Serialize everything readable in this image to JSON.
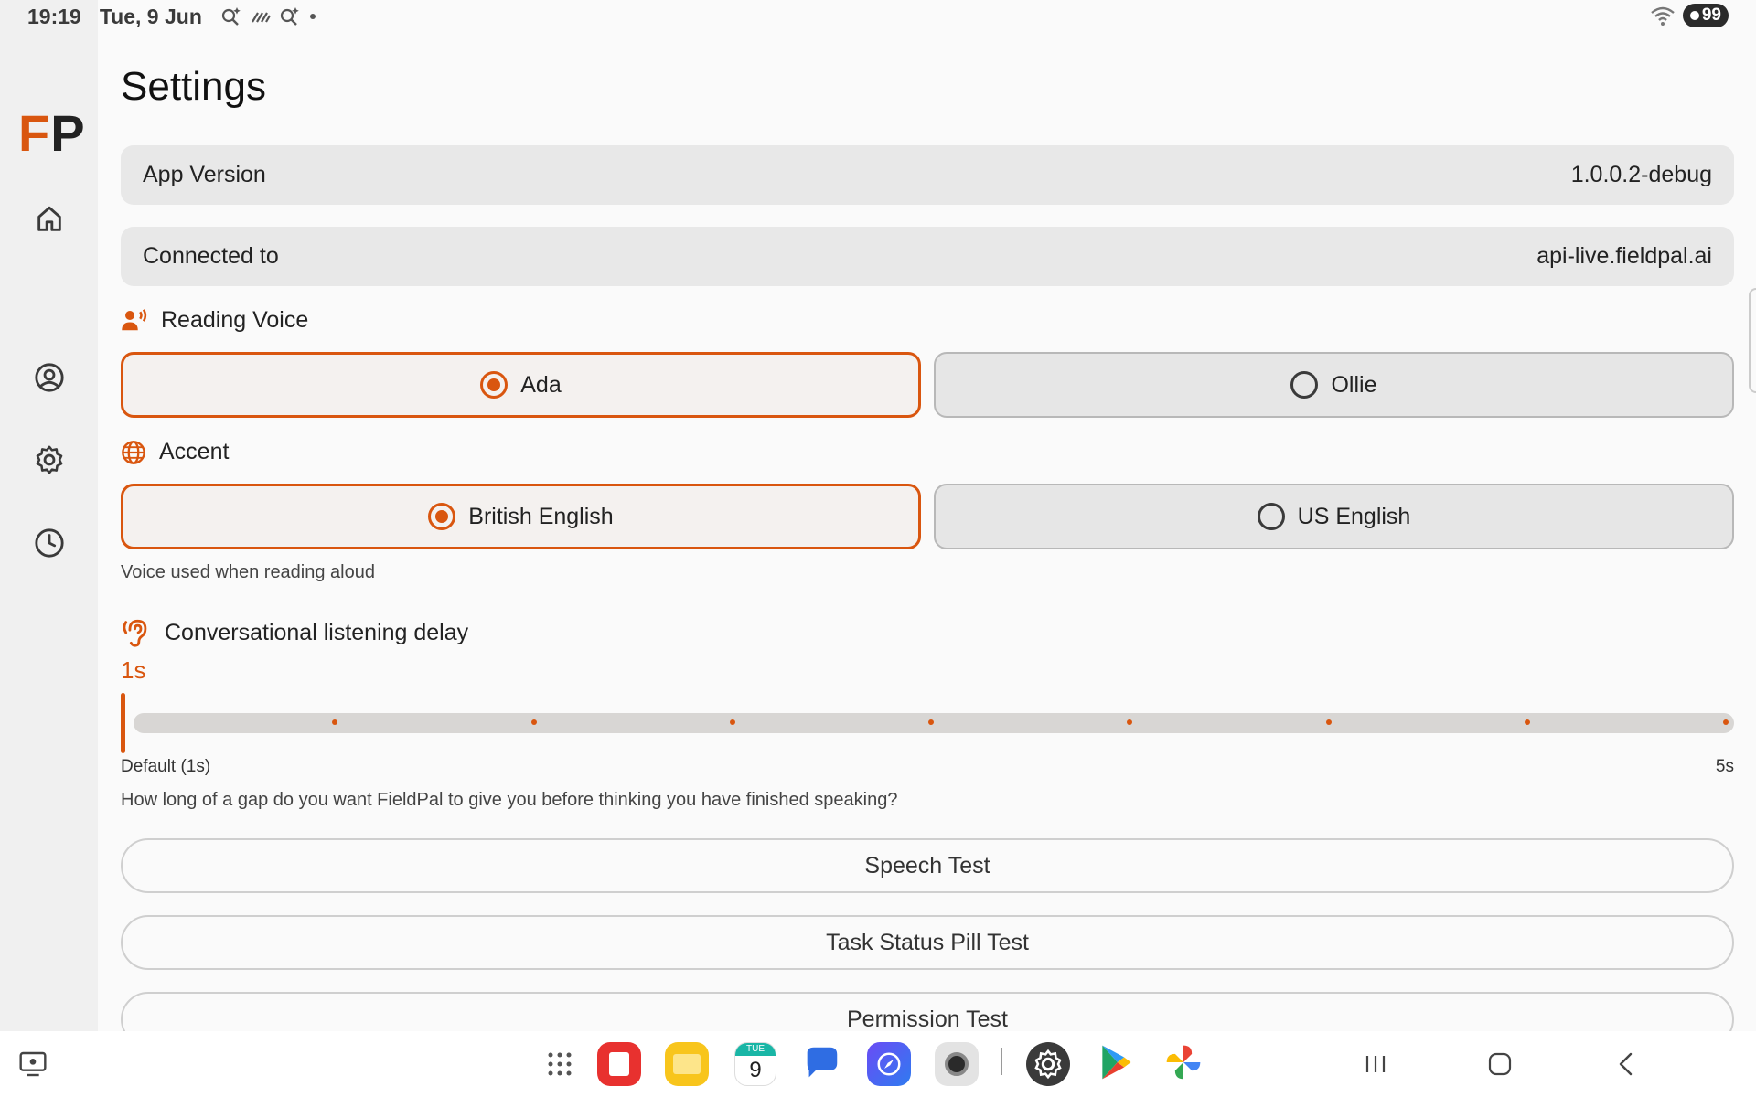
{
  "status_bar": {
    "time": "19:19",
    "date": "Tue, 9 Jun",
    "battery": "99"
  },
  "brand": {
    "logo_f": "F",
    "logo_p": "P",
    "accent_color": "#d9560f"
  },
  "rail": {
    "items": [
      "home-icon",
      "profile-icon",
      "settings-icon",
      "history-icon"
    ]
  },
  "settings": {
    "title": "Settings",
    "app_version_label": "App Version",
    "app_version_value": "1.0.0.2-debug",
    "connected_label": "Connected to",
    "connected_value": "api-live.fieldpal.ai",
    "reading_voice_label": "Reading Voice",
    "voices": [
      {
        "label": "Ada",
        "selected": true
      },
      {
        "label": "Ollie",
        "selected": false
      }
    ],
    "accent_label": "Accent",
    "accents": [
      {
        "label": "British English",
        "selected": true
      },
      {
        "label": "US English",
        "selected": false
      }
    ],
    "voice_hint": "Voice used when reading aloud",
    "delay_label": "Conversational listening delay",
    "delay_value": "1s",
    "delay_slider": {
      "min": 1,
      "max": 5,
      "value": 1,
      "steps": 9
    },
    "delay_min_label": "Default (1s)",
    "delay_max_label": "5s",
    "delay_hint": "How long of a gap do you want FieldPal to give you before thinking you have finished speaking?",
    "buttons": {
      "speech_test": "Speech Test",
      "task_status": "Task Status Pill Test",
      "permission_test": "Permission Test"
    }
  },
  "taskbar": {
    "calendar_day_label": "TUE",
    "calendar_day_number": "9",
    "apps": [
      "apps-grid-icon",
      "notes-app-icon",
      "files-app-icon",
      "calendar-app-icon",
      "messages-app-icon",
      "browser-app-icon",
      "camera-app-icon",
      "settings-app-icon",
      "play-store-icon",
      "photos-app-icon"
    ]
  }
}
